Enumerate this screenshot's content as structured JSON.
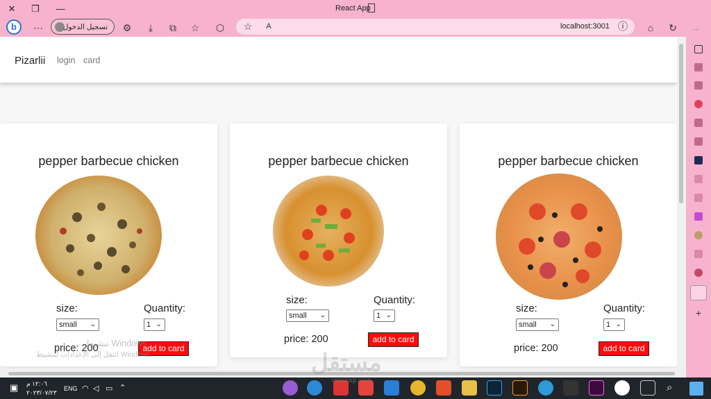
{
  "window": {
    "title": "React App"
  },
  "browser": {
    "profile_label": "تسجيل الدخول",
    "url": "localhost:3001"
  },
  "navbar": {
    "brand": "Pizarlii",
    "links": [
      "login",
      "card"
    ]
  },
  "products": [
    {
      "title": "pepper barbecue chicken",
      "size_label": "size:",
      "size_value": "small",
      "qty_label": "Quantity:",
      "qty_value": "1",
      "price": "price: 200",
      "button": "add to card"
    },
    {
      "title": "pepper barbecue chicken",
      "size_label": "size:",
      "size_value": "small",
      "qty_label": "Quantity:",
      "qty_value": "1",
      "price": "price: 200",
      "button": "add to card"
    },
    {
      "title": "pepper barbecue chicken",
      "size_label": "size:",
      "size_value": "small",
      "qty_label": "Quantity:",
      "qty_value": "1",
      "price": "price: 200",
      "button": "add to card"
    }
  ],
  "watermark": {
    "line1": "تنشيط Windows",
    "line2": "انتقل إلى الإعدادات لتنشيط Windows.",
    "site": "مستقل",
    "site_sub": "mostaql.com"
  },
  "taskbar": {
    "lang": "ENG",
    "time": "١٢:٠٦ م",
    "date": "٢٠٢٣/٠٧/٢٣"
  },
  "colors": {
    "button": "#ff0b0b",
    "frame": "#f7b3cd"
  }
}
